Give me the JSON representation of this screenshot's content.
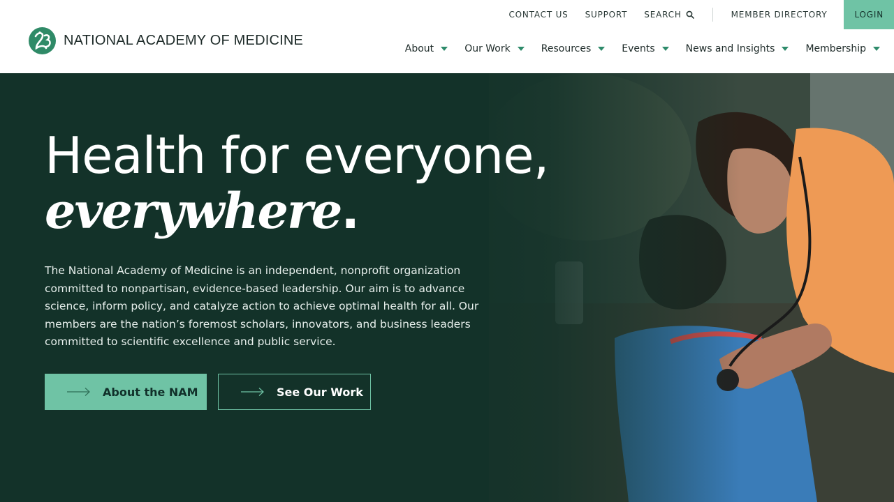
{
  "brand": {
    "name": "NATIONAL ACADEMY OF MEDICINE",
    "accent_color": "#6fc3a5",
    "hero_color": "#133229",
    "logo_icon": "nam-logo-icon"
  },
  "utility_nav": {
    "contact": "CONTACT US",
    "support": "SUPPORT",
    "search": "SEARCH",
    "directory": "MEMBER DIRECTORY",
    "login": "LOGIN"
  },
  "main_nav": {
    "items": [
      {
        "label": "About",
        "icon": "chevron-down-icon"
      },
      {
        "label": "Our Work",
        "icon": "chevron-down-icon"
      },
      {
        "label": "Resources",
        "icon": "chevron-down-icon"
      },
      {
        "label": "Events",
        "icon": "chevron-down-icon"
      },
      {
        "label": "News and Insights",
        "icon": "chevron-down-icon"
      },
      {
        "label": "Membership",
        "icon": "chevron-down-icon"
      }
    ]
  },
  "hero": {
    "headline_line1": "Health for everyone,",
    "headline_line2": "everywhere",
    "headline_period": ".",
    "intro": "The National Academy of Medicine is an independent, nonprofit organization committed to nonpartisan, evidence-based leadership. Our aim is to advance science, inform policy, and catalyze action to achieve optimal health for all. Our members are the nation’s foremost scholars, innovators, and business leaders committed to scientific excellence and public service.",
    "primary_button": "About the NAM",
    "secondary_button": "See Our Work",
    "button_icon": "arrow-right-icon"
  }
}
